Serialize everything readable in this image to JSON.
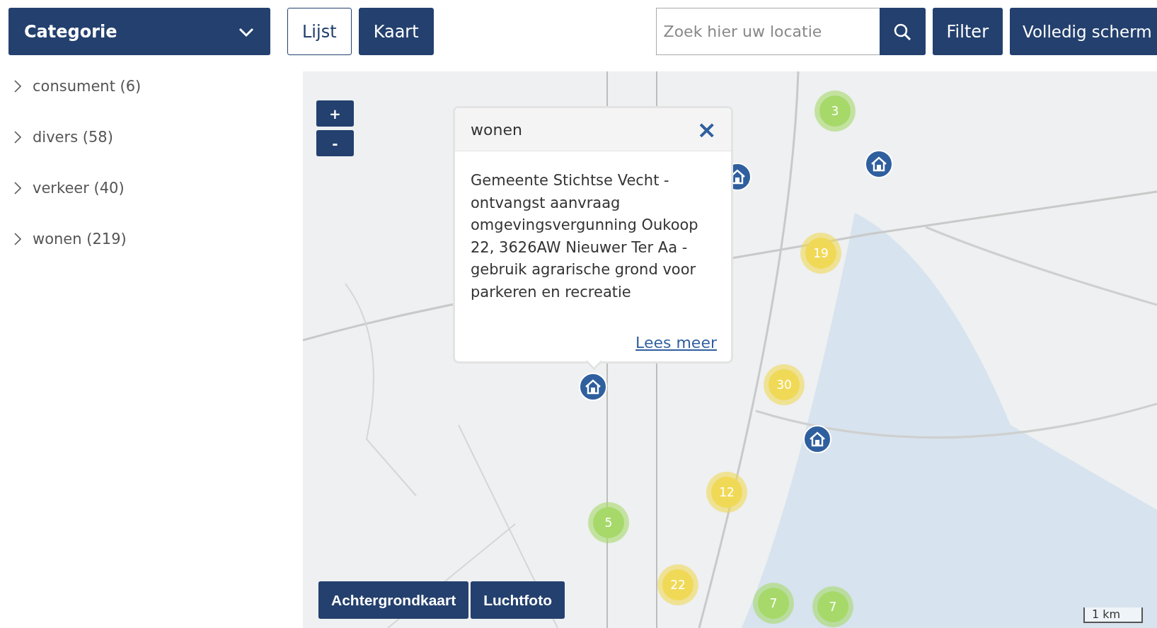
{
  "category_dropdown": {
    "label": "Categorie"
  },
  "view_tabs": [
    {
      "label": "Lijst",
      "selected": false
    },
    {
      "label": "Kaart",
      "selected": true
    }
  ],
  "search": {
    "placeholder": "Zoek hier uw locatie"
  },
  "buttons": {
    "filter": "Filter",
    "fullscreen": "Volledig scherm"
  },
  "categories": [
    {
      "label": "consument (6)",
      "expanded": false
    },
    {
      "label": "divers (58)",
      "expanded": false
    },
    {
      "label": "verkeer (40)",
      "expanded": false
    },
    {
      "label": "wonen (219)",
      "expanded": false
    }
  ],
  "map": {
    "zoom_in": "+",
    "zoom_out": "-",
    "clusters": [
      {
        "count": "3",
        "color": "#a6d96a"
      },
      {
        "count": "19",
        "color": "#f0d957"
      },
      {
        "count": "30",
        "color": "#f0d957"
      },
      {
        "count": "12",
        "color": "#f0d957"
      },
      {
        "count": "5",
        "color": "#a6d96a"
      },
      {
        "count": "22",
        "color": "#f0d957"
      },
      {
        "count": "7",
        "color": "#a6d96a"
      },
      {
        "count": "7",
        "color": "#a6d96a"
      }
    ],
    "popup": {
      "title": "wonen",
      "close": "×",
      "body": "Gemeente Stichtse Vecht - ontvangst aanvraag omgevingsvergunning Oukoop 22, 3626AW Nieuwer Ter Aa - gebruik agrarische grond voor parkeren en recreatie",
      "link": "Lees meer"
    },
    "layers": [
      {
        "label": "Achtergrondkaart"
      },
      {
        "label": "Luchtfoto"
      }
    ],
    "scale": "1 km"
  }
}
